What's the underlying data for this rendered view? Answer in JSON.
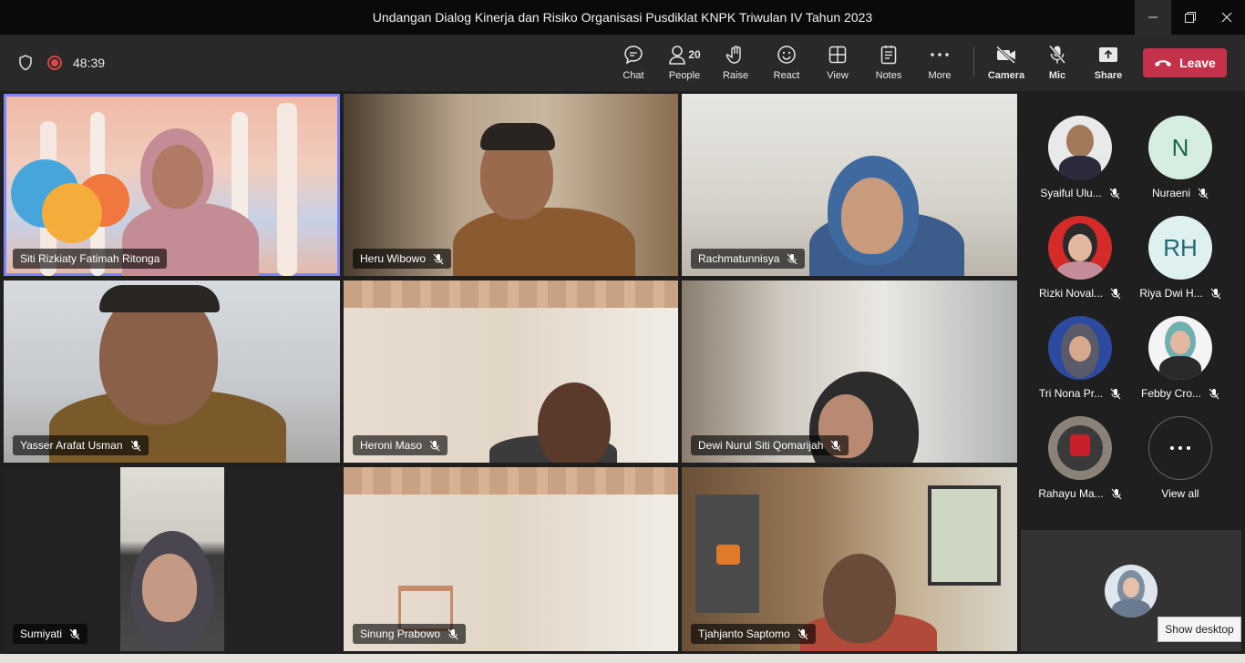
{
  "window": {
    "title": "Undangan Dialog Kinerja dan Risiko Organisasi Pusdiklat KNPK Triwulan IV Tahun 2023"
  },
  "toolbar": {
    "timer": "48:39",
    "chat_label": "Chat",
    "people_label": "People",
    "people_count": "20",
    "raise_label": "Raise",
    "react_label": "React",
    "view_label": "View",
    "notes_label": "Notes",
    "more_label": "More",
    "camera_label": "Camera",
    "mic_label": "Mic",
    "share_label": "Share",
    "leave_label": "Leave"
  },
  "tiles": [
    {
      "name": "Siti Rizkiaty Fatimah Ritonga",
      "muted": false,
      "active": true
    },
    {
      "name": "Heru Wibowo",
      "muted": true
    },
    {
      "name": "Rachmatunnisya",
      "muted": true
    },
    {
      "name": "Yasser Arafat Usman",
      "muted": true
    },
    {
      "name": "Heroni Maso",
      "muted": true
    },
    {
      "name": "Dewi Nurul Siti Qomarijah",
      "muted": true
    },
    {
      "name": "Sumiyati",
      "muted": true
    },
    {
      "name": "Sinung Prabowo",
      "muted": true
    },
    {
      "name": "Tjahjanto Saptomo",
      "muted": true
    }
  ],
  "sidebar": {
    "participants": [
      {
        "name": "Syaiful Ulu...",
        "initials": ""
      },
      {
        "name": "Nuraeni",
        "initials": "N"
      },
      {
        "name": "Rizki Noval...",
        "initials": ""
      },
      {
        "name": "Riya Dwi H...",
        "initials": "RH"
      },
      {
        "name": "Tri Nona Pr...",
        "initials": ""
      },
      {
        "name": "Febby Cro...",
        "initials": ""
      },
      {
        "name": "Rahayu Ma...",
        "initials": ""
      }
    ],
    "view_all_label": "View all"
  },
  "tooltip": "Show desktop",
  "colors": {
    "accent": "#7f85f5",
    "leave": "#c4314b",
    "toolbar": "#292929",
    "titlebar": "#0a0a0a"
  }
}
